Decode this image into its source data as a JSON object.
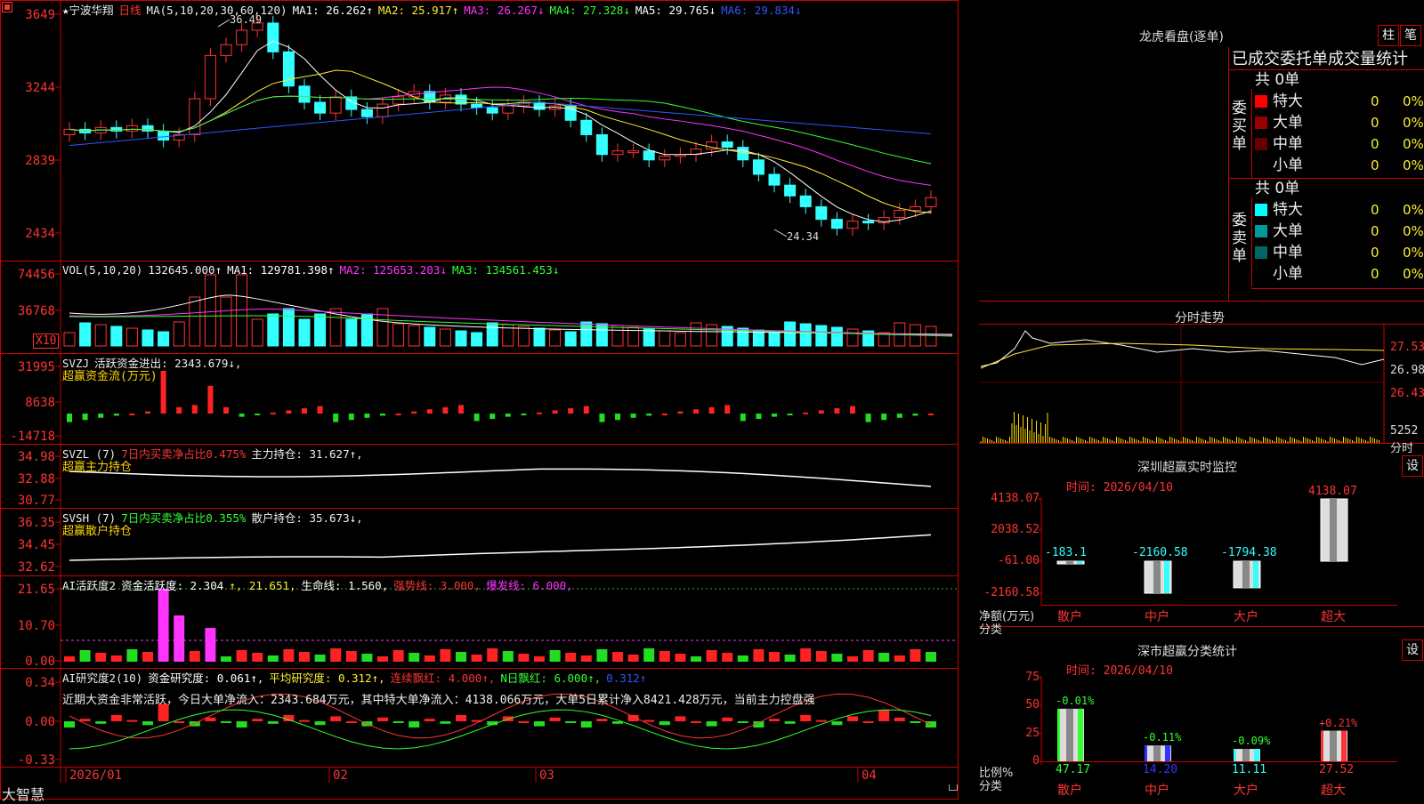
{
  "app": {
    "brand": "大智慧",
    "corner_icon": "record-icon"
  },
  "main": {
    "stock_name": "★宁波华翔",
    "period": "日线",
    "ma_label": "MA(5,10,20,30,60,120)",
    "ma_values": [
      {
        "label": "MA1: 26.262↑",
        "color": "#ffffff"
      },
      {
        "label": "MA2: 25.917↑",
        "color": "#ffee33"
      },
      {
        "label": "MA3: 26.267↓",
        "color": "#ff33ff"
      },
      {
        "label": "MA4: 27.328↓",
        "color": "#33ff33"
      },
      {
        "label": "MA5: 29.765↓",
        "color": "#ffffff"
      },
      {
        "label": "MA6: 29.834↓",
        "color": "#3355ff"
      }
    ],
    "yticks": [
      "3649",
      "3244",
      "2839",
      "2434"
    ],
    "high_label": "36.49",
    "low_label": "24.34"
  },
  "vol": {
    "label": "VOL(5,10,20)",
    "value": "132645.000↑",
    "ma": [
      {
        "label": "MA1: 129781.398↑",
        "color": "#ffffff"
      },
      {
        "label": "MA2: 125653.203↓",
        "color": "#ff33ff"
      },
      {
        "label": "MA3: 134561.453↓",
        "color": "#33ff33"
      }
    ],
    "yticks": [
      "74456",
      "36768"
    ],
    "unit": "X10"
  },
  "svzj": {
    "label": "SVZJ",
    "desc": "活跃资金进出: 2343.679↓,",
    "subtitle": "超赢资金流(万元)",
    "yticks": [
      "31995",
      "8638",
      "-14718"
    ]
  },
  "svzl": {
    "label": "SVZL (7)",
    "desc1": "7日内买卖净占比0.475%",
    "desc2": "主力持仓: 31.627↑,",
    "subtitle": "超赢主力持仓",
    "yticks": [
      "34.98",
      "32.88",
      "30.77"
    ]
  },
  "svsh": {
    "label": "SVSH (7)",
    "desc1": "7日内买卖净占比0.355%",
    "desc2": "散户持仓: 35.673↓,",
    "subtitle": "超赢散户持仓",
    "yticks": [
      "36.35",
      "34.45",
      "32.62"
    ]
  },
  "ai1": {
    "label": "AI活跃度2",
    "items": [
      {
        "label": "资金活跃度: 2.304",
        "color": "#ffffff"
      },
      {
        "label": "↑, 21.651,",
        "color": "#ffee33"
      },
      {
        "label": "生命线: 1.560,",
        "color": "#ffffff"
      },
      {
        "label": "强势线: 3.000,",
        "color": "#ff3333"
      },
      {
        "label": "爆发线: 6.000,",
        "color": "#ff33ff"
      }
    ],
    "yticks": [
      "21.65",
      "10.70",
      "0.00"
    ]
  },
  "ai2": {
    "label": "AI研究度2(10)",
    "items": [
      {
        "label": "资金研究度: 0.061↑,",
        "color": "#ffffff"
      },
      {
        "label": "平均研究度: 0.312↑,",
        "color": "#ffee33"
      },
      {
        "label": "连续飘红: 4.000↑,",
        "color": "#ff3333"
      },
      {
        "label": "N日飘红: 6.000↑,",
        "color": "#33ff33"
      },
      {
        "label": "0.312↑",
        "color": "#3355ff"
      }
    ],
    "commentary": "近期大资金非常活跃，今日大单净流入：2343.684万元，其中特大单净流入：4138.066万元，大单5日累计净入8421.428万元，当前主力控盘强",
    "yticks": [
      "0.34",
      "0.00",
      "-0.33"
    ]
  },
  "xaxis": {
    "labels": [
      "2026/01",
      "02",
      "03",
      "04"
    ],
    "lock_icon": "lock-icon"
  },
  "dragon": {
    "title": "龙虎看盘(逐单)",
    "btn_bar": "柱",
    "btn_pen": "笔",
    "header": "已成交委托单成交量统计",
    "buy": {
      "side_label": "委买单",
      "total": "共 0单",
      "rows": [
        {
          "name": "特大",
          "count": "0",
          "pct": "0%",
          "color": "#ff0000"
        },
        {
          "name": "大单",
          "count": "0",
          "pct": "0%",
          "color": "#990000"
        },
        {
          "name": "中单",
          "count": "0",
          "pct": "0%",
          "color": "#660000"
        },
        {
          "name": "小单",
          "count": "0",
          "pct": "0%",
          "color": "#000000"
        }
      ]
    },
    "sell": {
      "side_label": "委卖单",
      "total": "共 0单",
      "rows": [
        {
          "name": "特大",
          "count": "0",
          "pct": "0%",
          "color": "#00ffff"
        },
        {
          "name": "大单",
          "count": "0",
          "pct": "0%",
          "color": "#009999"
        },
        {
          "name": "中单",
          "count": "0",
          "pct": "0%",
          "color": "#006666"
        },
        {
          "name": "小单",
          "count": "0",
          "pct": "0%",
          "color": "#000000"
        }
      ]
    }
  },
  "intraday": {
    "title": "分时走势",
    "yticks": [
      "27.53",
      "26.98",
      "26.43"
    ],
    "vol_value": "5252",
    "vol_unit": "分时"
  },
  "monitor": {
    "title": "深圳超赢实时监控",
    "set_btn": "设",
    "time": "时间: 2026/04/10",
    "yticks": [
      "4138.07",
      "2038.52",
      "-61.00",
      "-2160.58"
    ],
    "ylabel1": "净额(万元)",
    "ylabel2": "分类",
    "bars": [
      {
        "name": "散户",
        "value": -183.1,
        "label": "-183.1"
      },
      {
        "name": "中户",
        "value": -2160.58,
        "label": "-2160.58"
      },
      {
        "name": "大户",
        "value": -1794.38,
        "label": "-1794.38"
      },
      {
        "name": "超大",
        "value": 4138.07,
        "label": "4138.07"
      }
    ]
  },
  "classify": {
    "title": "深市超赢分类统计",
    "set_btn": "设",
    "time": "时间: 2026/04/10",
    "yticks": [
      "75",
      "50",
      "25",
      "0"
    ],
    "ylabel1": "比例%",
    "ylabel2": "分类",
    "bars": [
      {
        "name": "散户",
        "value": 47.17,
        "label": "47.17",
        "change": "-0.01%",
        "color": "#33ff33"
      },
      {
        "name": "中户",
        "value": 14.2,
        "label": "14.20",
        "change": "-0.11%",
        "color": "#3333ff"
      },
      {
        "name": "大户",
        "value": 11.11,
        "label": "11.11",
        "change": "-0.09%",
        "color": "#33ffff"
      },
      {
        "name": "超大",
        "value": 27.52,
        "label": "27.52",
        "change": "+0.21%",
        "color": "#ff3333"
      }
    ]
  }
}
